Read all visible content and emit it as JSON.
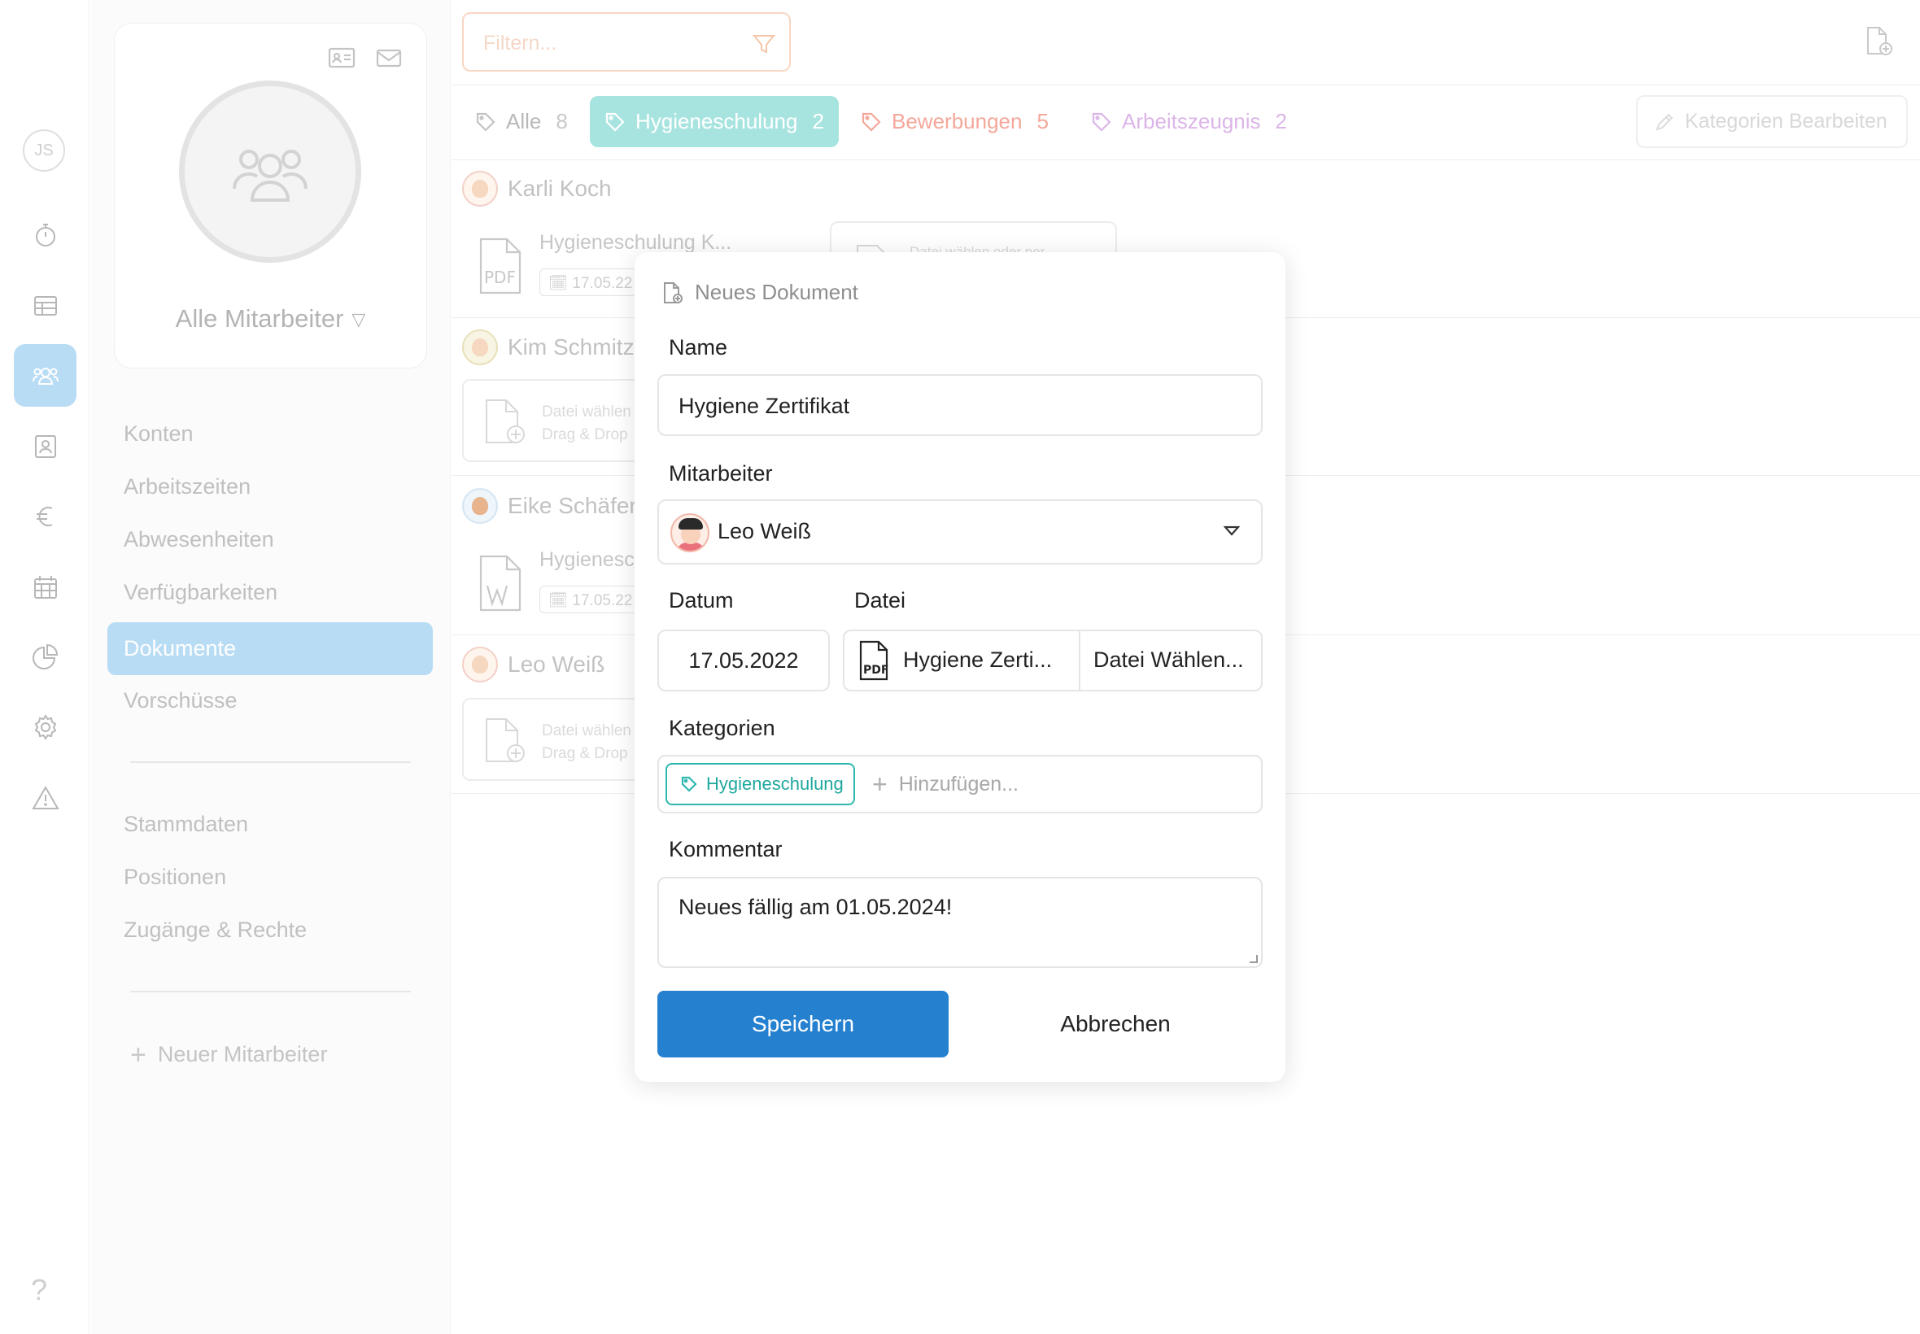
{
  "rail": {
    "avatar_initials": "JS",
    "help": "?",
    "items": [
      {
        "icon": "stopwatch-icon",
        "active": false
      },
      {
        "icon": "table-icon",
        "active": false
      },
      {
        "icon": "users-icon",
        "active": true
      },
      {
        "icon": "contact-card-icon",
        "active": false
      },
      {
        "icon": "euro-icon",
        "active": false
      },
      {
        "icon": "calendar-icon",
        "active": false
      },
      {
        "icon": "pie-chart-icon",
        "active": false
      },
      {
        "icon": "gear-icon",
        "active": false
      },
      {
        "icon": "warning-icon",
        "active": false
      }
    ]
  },
  "sidebar": {
    "selector_label": "Alle Mitarbeiter",
    "nav": [
      {
        "label": "Konten"
      },
      {
        "label": "Arbeitszeiten"
      },
      {
        "label": "Abwesenheiten"
      },
      {
        "label": "Verfügbarkeiten"
      },
      {
        "label": "Dokumente",
        "active": true
      },
      {
        "label": "Vorschüsse"
      }
    ],
    "nav2": [
      {
        "label": "Stammdaten"
      },
      {
        "label": "Positionen"
      },
      {
        "label": "Zugänge & Rechte"
      }
    ],
    "new_staff": "Neuer Mitarbeiter"
  },
  "toolbar": {
    "filter_placeholder": "Filtern...",
    "edit_categories": "Kategorien Bearbeiten"
  },
  "tabs": [
    {
      "label": "Alle",
      "count": "8",
      "color": "#b9b9b9"
    },
    {
      "label": "Hygieneschulung",
      "count": "2",
      "color": "#ffffff",
      "active": true,
      "bg": "#a8e4df"
    },
    {
      "label": "Bewerbungen",
      "count": "5",
      "color": "#f4a79a"
    },
    {
      "label": "Arbeitszeugnis",
      "count": "2",
      "color": "#dcb5e8"
    }
  ],
  "employees": [
    {
      "name": "Karli Koch",
      "doc_title": "Hygieneschulung K...",
      "doc_date": "17.05.22",
      "drop_text": "Datei wählen oder per"
    },
    {
      "name": "Kim Schmitz",
      "drop_text1": "Datei wählen",
      "drop_text2": "Drag & Drop"
    },
    {
      "name": "Eike Schäfer",
      "doc_title": "Hygienesc",
      "doc_date": "17.05.22"
    },
    {
      "name": "Leo Weiß",
      "drop_text1": "Datei wählen",
      "drop_text2": "Drag & Drop"
    }
  ],
  "modal": {
    "title": "Neues Dokument",
    "name_label": "Name",
    "name_value": "Hygiene Zertifikat",
    "employee_label": "Mitarbeiter",
    "employee_value": "Leo Weiß",
    "date_label": "Datum",
    "date_value": "17.05.2022",
    "file_label": "Datei",
    "file_name": "Hygiene Zerti...",
    "file_choose": "Datei Wählen...",
    "categories_label": "Kategorien",
    "category_chip": "Hygieneschulung",
    "category_add": "Hinzufügen...",
    "comment_label": "Kommentar",
    "comment_value": "Neues fällig am 01.05.2024!",
    "save": "Speichern",
    "cancel": "Abbrechen",
    "accent": "#2580d0"
  }
}
